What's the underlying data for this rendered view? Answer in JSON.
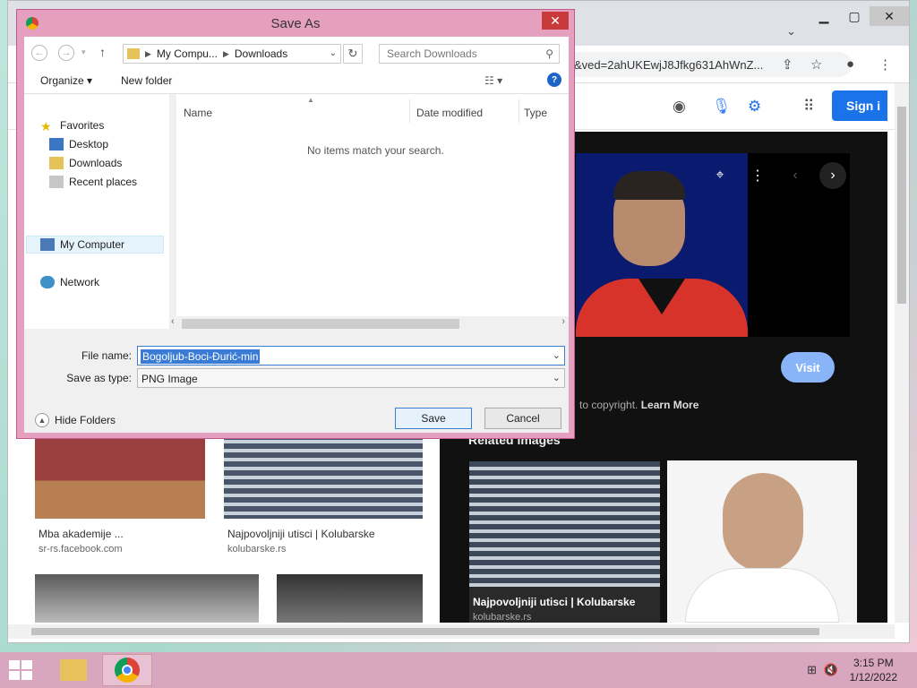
{
  "browser": {
    "url": "&ved=2ahUKEwjJ8Jfkg631AhWnZ...",
    "sign_in": "Sign i"
  },
  "results": [
    {
      "caption": "Mba akademije ...",
      "source": "sr-rs.facebook.com"
    },
    {
      "caption": "Najpovoljniji utisci | Kolubarske",
      "source": "kolubarske.rs"
    }
  ],
  "panel": {
    "visit": "Visit",
    "copyright_prefix": "to copyright.",
    "learn_more": "Learn More",
    "related_title": "Related images",
    "related": [
      {
        "caption": "Najpovoljniji utisci | Kolubarske",
        "source": "kolubarske.rs"
      }
    ]
  },
  "dialog": {
    "title": "Save As",
    "breadcrumb": [
      "My Compu...",
      "Downloads"
    ],
    "search_placeholder": "Search Downloads",
    "organize": "Organize",
    "new_folder": "New folder",
    "nav": {
      "favorites": "Favorites",
      "desktop": "Desktop",
      "downloads": "Downloads",
      "recent_places": "Recent places",
      "my_computer": "My Computer",
      "network": "Network"
    },
    "columns": {
      "name": "Name",
      "date_modified": "Date modified",
      "type": "Type"
    },
    "empty_message": "No items match your search.",
    "file_name_label": "File name:",
    "file_name_value": "Bogoljub-Boci-Đurić-min",
    "save_as_type_label": "Save as type:",
    "save_as_type_value": "PNG Image",
    "hide_folders": "Hide Folders",
    "save": "Save",
    "cancel": "Cancel"
  },
  "taskbar": {
    "time": "3:15 PM",
    "date": "1/12/2022"
  }
}
